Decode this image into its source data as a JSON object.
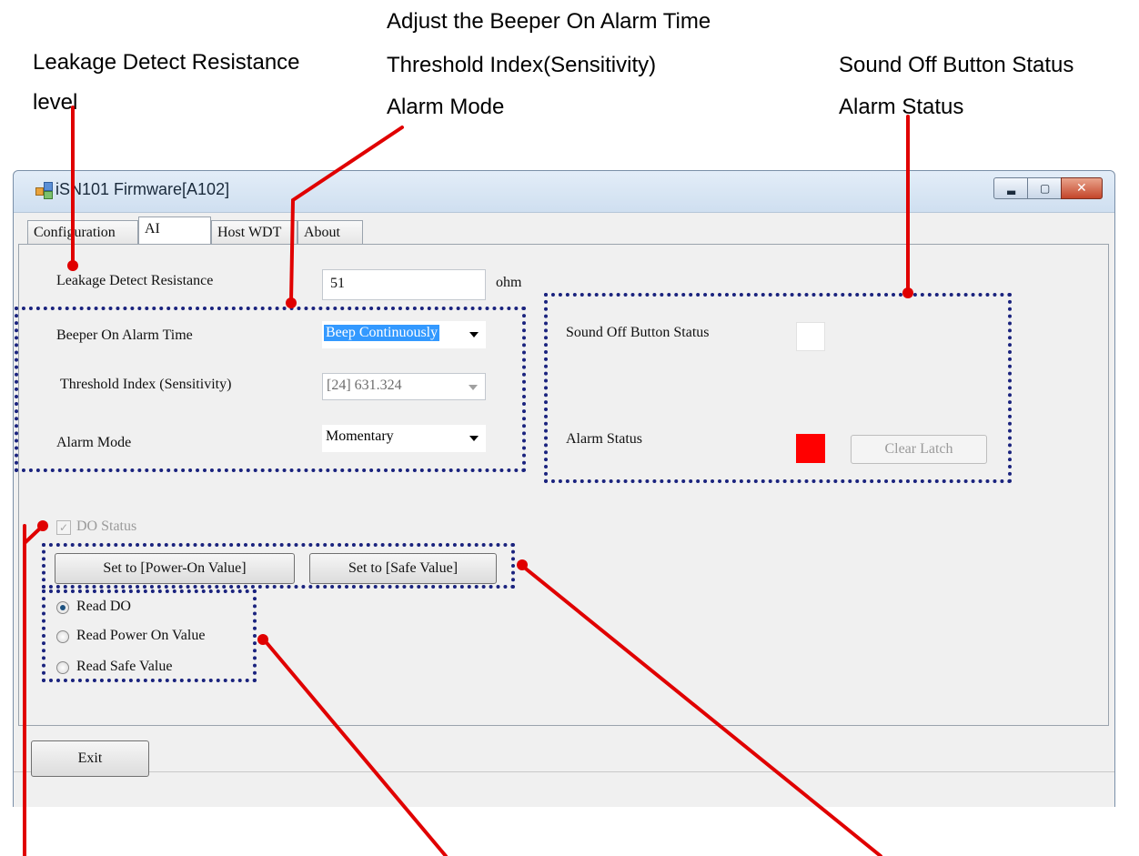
{
  "annotations": {
    "leakage_line1": "Leakage Detect Resistance",
    "leakage_line2": "level",
    "beeper_line1": "Adjust the Beeper On Alarm Time",
    "beeper_line2": "Threshold Index(Sensitivity)",
    "beeper_line3": "Alarm Mode",
    "status_line1": "Sound Off Button Status",
    "status_line2": "Alarm Status"
  },
  "window": {
    "title": "iSN101 Firmware[A102]"
  },
  "tabs": [
    {
      "label": "Configuration"
    },
    {
      "label": "AI"
    },
    {
      "label": "Host WDT"
    },
    {
      "label": "About"
    }
  ],
  "leakage": {
    "label": "Leakage Detect Resistance",
    "value": "51",
    "unit": "ohm"
  },
  "beeper": {
    "label": "Beeper On Alarm Time",
    "value": "Beep Continuously"
  },
  "threshold": {
    "label": "Threshold Index (Sensitivity)",
    "value": "[24] 631.324"
  },
  "alarm_mode": {
    "label": "Alarm Mode",
    "value": "Momentary"
  },
  "sound_off": {
    "label": "Sound Off Button Status",
    "indicator_color": "#ffffff"
  },
  "alarm_status": {
    "label": "Alarm Status",
    "indicator_color": "#ff0000"
  },
  "clear_latch_label": "Clear Latch",
  "do_status": {
    "label": "DO Status",
    "checked": true
  },
  "buttons": {
    "power_on": "Set to [Power-On Value]",
    "safe": "Set to [Safe Value]",
    "exit": "Exit"
  },
  "radios": [
    {
      "label": "Read DO",
      "selected": true
    },
    {
      "label": "Read Power On Value",
      "selected": false
    },
    {
      "label": "Read Safe Value",
      "selected": false
    }
  ],
  "colors": {
    "callout_line": "#e00000",
    "dotted_frame": "#1a237e"
  }
}
